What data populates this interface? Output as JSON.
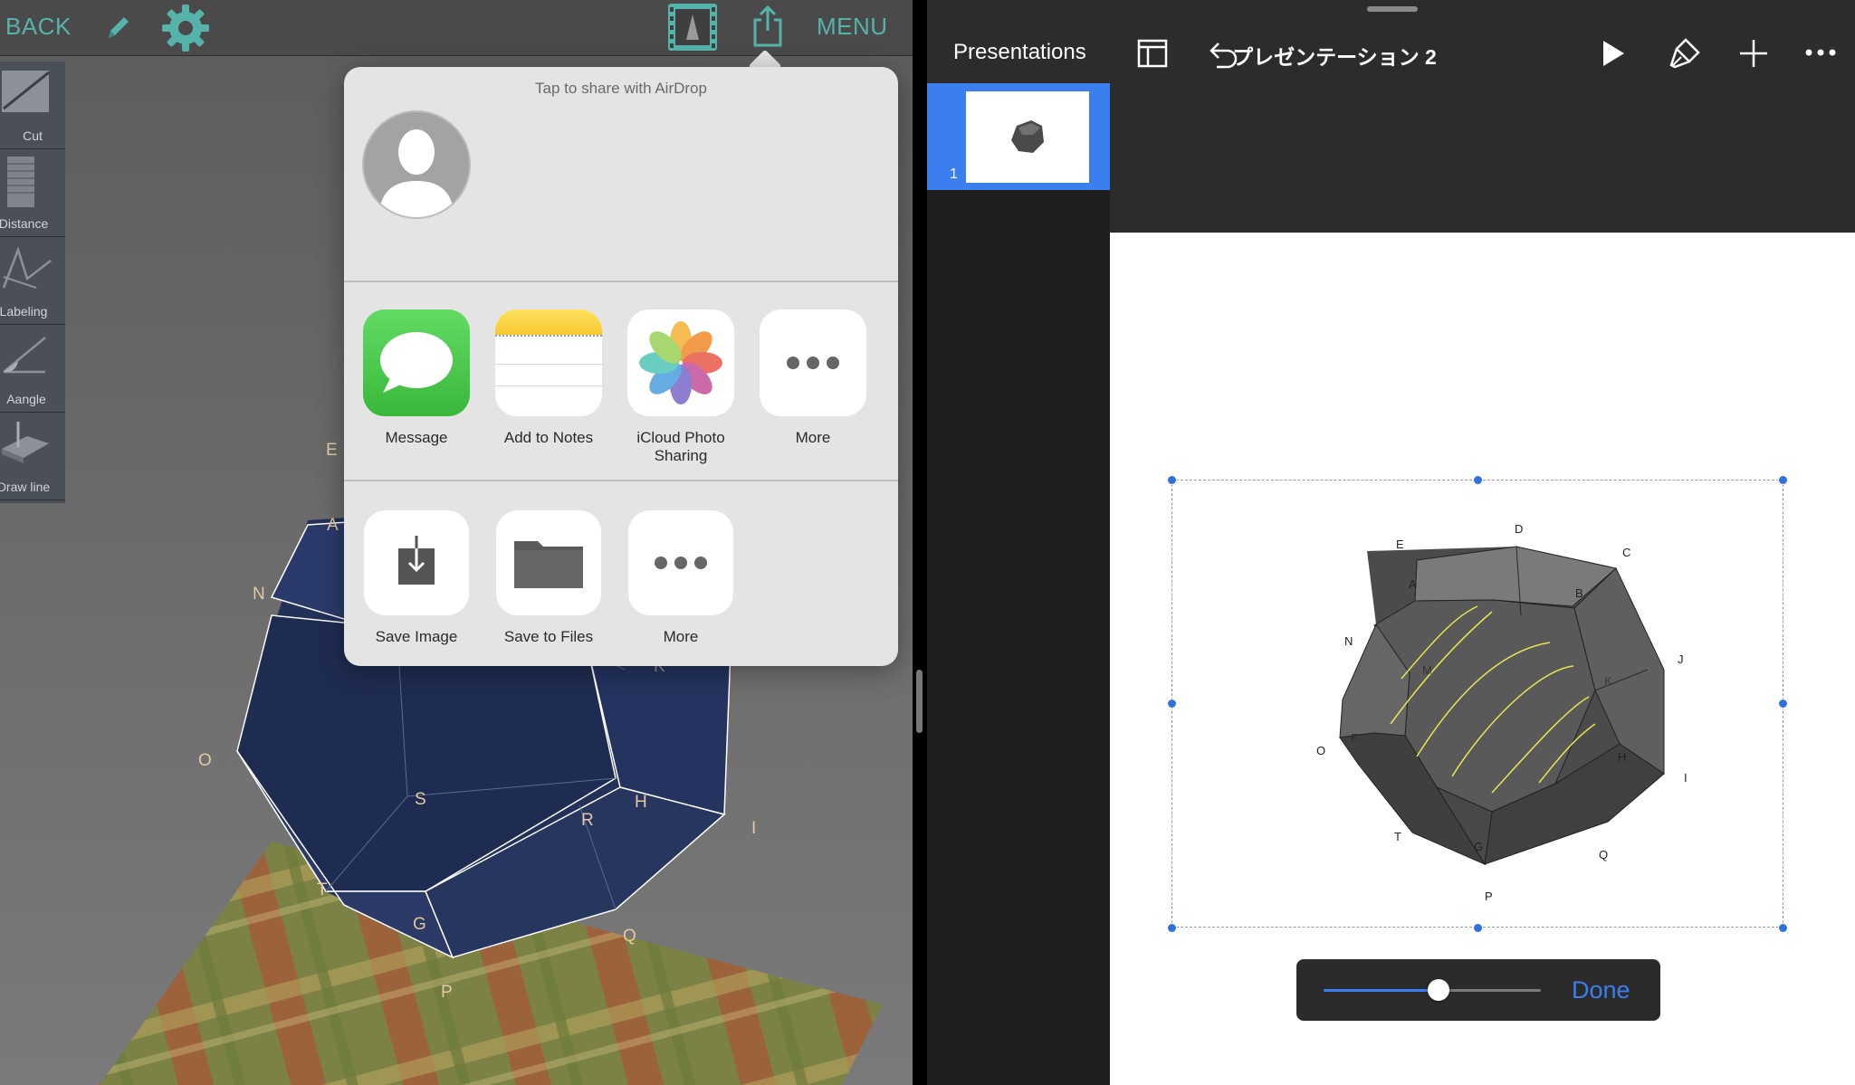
{
  "left_app": {
    "toolbar": {
      "back_label": "BACK",
      "menu_label": "MENU",
      "icons": [
        "pencil-icon",
        "gear-icon",
        "film-icon",
        "share-icon"
      ]
    },
    "tools": [
      {
        "label": "Cut",
        "icon": "cut-tool-icon"
      },
      {
        "label": "Distance",
        "icon": "distance-tool-icon"
      },
      {
        "label": "Labeling",
        "icon": "labeling-tool-icon"
      },
      {
        "label": "Aangle",
        "icon": "angle-tool-icon"
      },
      {
        "label": "Draw line",
        "icon": "draw-line-tool-icon"
      }
    ],
    "vertex_labels": [
      "E",
      "A",
      "N",
      "O",
      "S",
      "R",
      "H",
      "I",
      "T",
      "G",
      "Q",
      "P",
      "K"
    ],
    "colors": {
      "accent": "#56b3a9",
      "solid_fill": "#1f2c4f"
    }
  },
  "share_sheet": {
    "airdrop_title": "Tap to share with AirDrop",
    "apps": [
      {
        "label": "Message",
        "icon": "messages-icon"
      },
      {
        "label": "Add to Notes",
        "icon": "notes-icon"
      },
      {
        "label": "iCloud Photo Sharing",
        "icon": "photos-icon"
      },
      {
        "label": "More",
        "icon": "more-icon"
      }
    ],
    "actions": [
      {
        "label": "Save Image",
        "icon": "save-image-icon"
      },
      {
        "label": "Save to Files",
        "icon": "folder-icon"
      },
      {
        "label": "More",
        "icon": "more-icon"
      }
    ]
  },
  "right_app": {
    "toolbar": {
      "back_label": "Presentations",
      "title": "プレゼンテーション 2",
      "icons": [
        "layout-icon",
        "undo-icon",
        "play-icon",
        "format-brush-icon",
        "add-icon",
        "more-icon"
      ]
    },
    "slides": [
      {
        "number": "1"
      }
    ],
    "slide_labels": [
      "D",
      "E",
      "C",
      "A",
      "B",
      "N",
      "J",
      "M",
      "K",
      "F",
      "O",
      "H",
      "I",
      "T",
      "G",
      "Q",
      "P"
    ],
    "zoom_slider": {
      "value": 0.53
    },
    "done_label": "Done",
    "colors": {
      "accent": "#3a7ef0"
    }
  }
}
